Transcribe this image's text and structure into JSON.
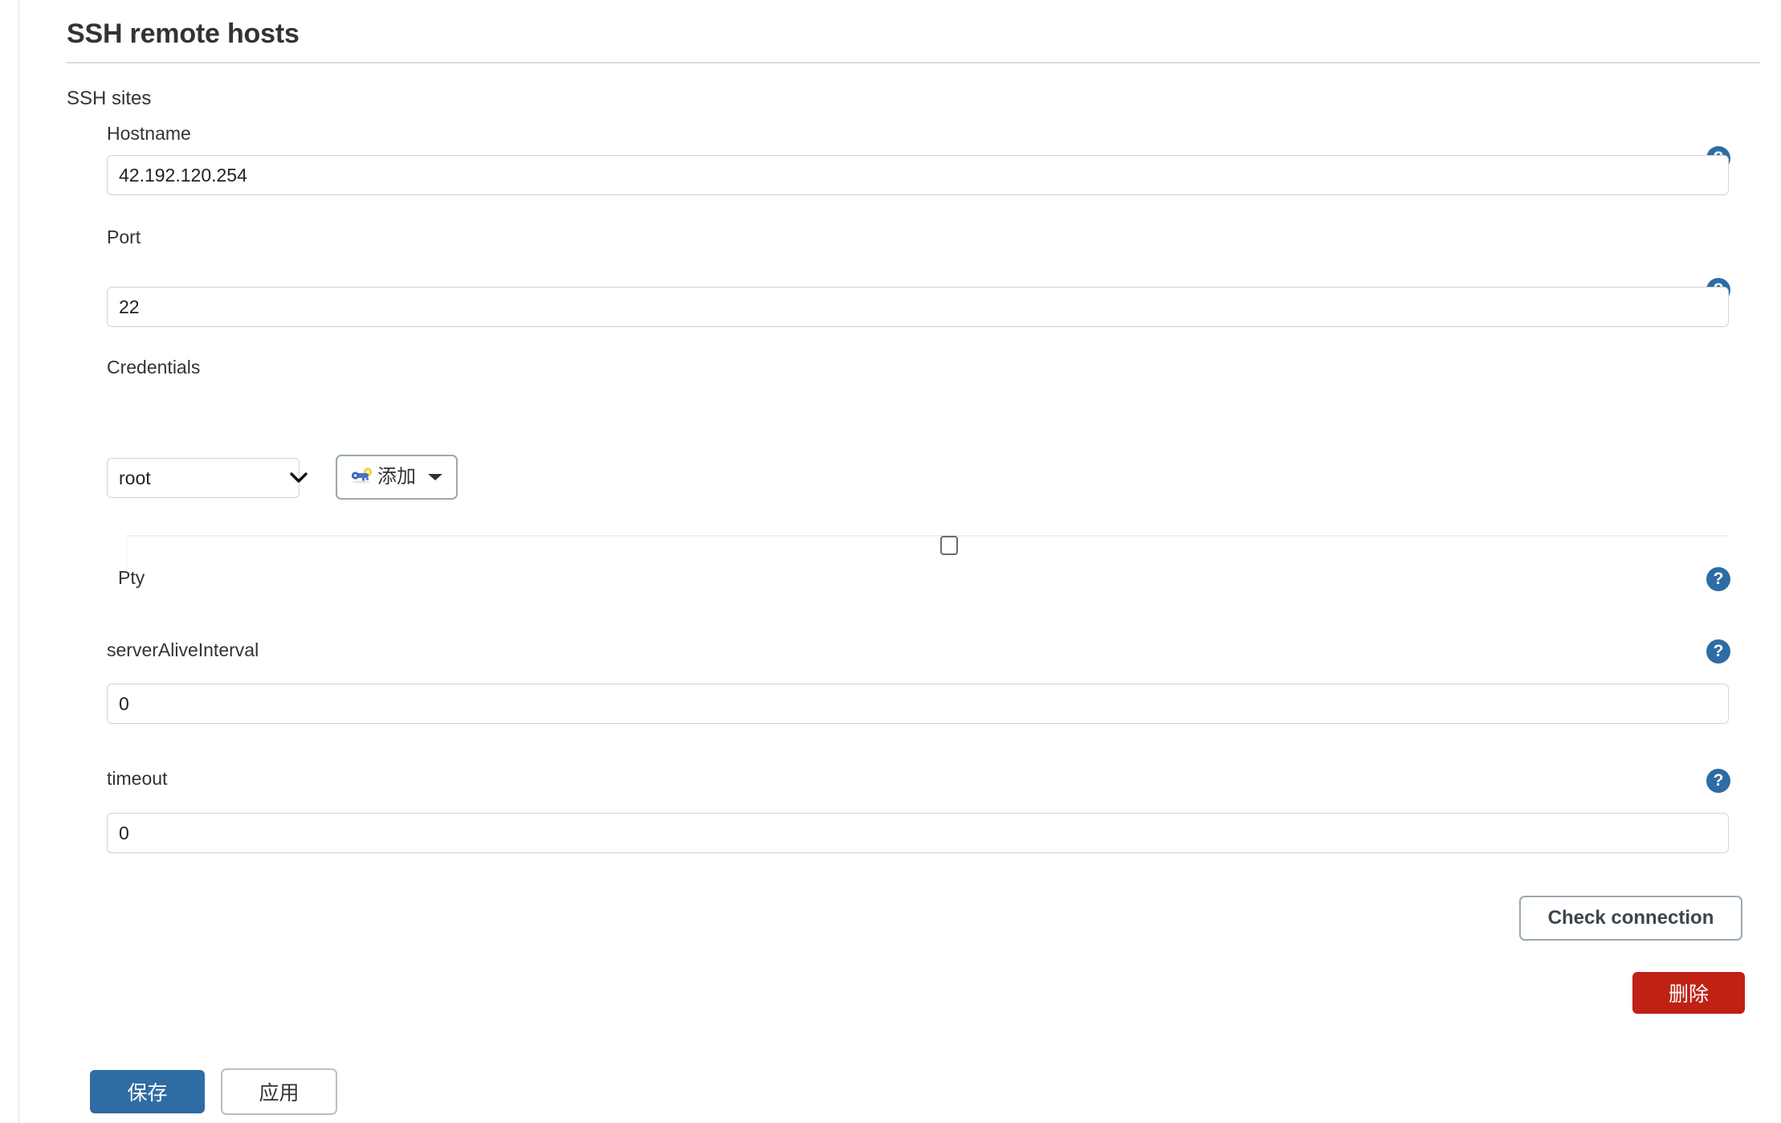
{
  "header": {
    "title": "SSH remote hosts",
    "section_label": "SSH sites"
  },
  "fields": {
    "hostname": {
      "label": "Hostname",
      "value": "42.192.120.254",
      "help": "?"
    },
    "port": {
      "label": "Port",
      "value": "22",
      "help": "?"
    },
    "credentials": {
      "label": "Credentials",
      "selected": "root",
      "options": [
        "root"
      ],
      "add_button_label": "添加",
      "add_button_icon": "key-icon",
      "caret_icon": "chevron-down-icon"
    },
    "pty": {
      "label": "Pty",
      "checked": false,
      "help": "?"
    },
    "server_alive_interval": {
      "label": "serverAliveInterval",
      "value": "0",
      "help": "?"
    },
    "timeout": {
      "label": "timeout",
      "value": "0",
      "help": "?"
    }
  },
  "actions": {
    "check_connection": "Check connection",
    "delete": "删除",
    "save": "保存",
    "apply": "应用"
  },
  "colors": {
    "primary_blue": "#2e6ca4",
    "danger_red": "#bf2114",
    "border_gray": "#d3d3d3",
    "outline_gray": "#9aa9b3",
    "text_dark": "#333333"
  }
}
